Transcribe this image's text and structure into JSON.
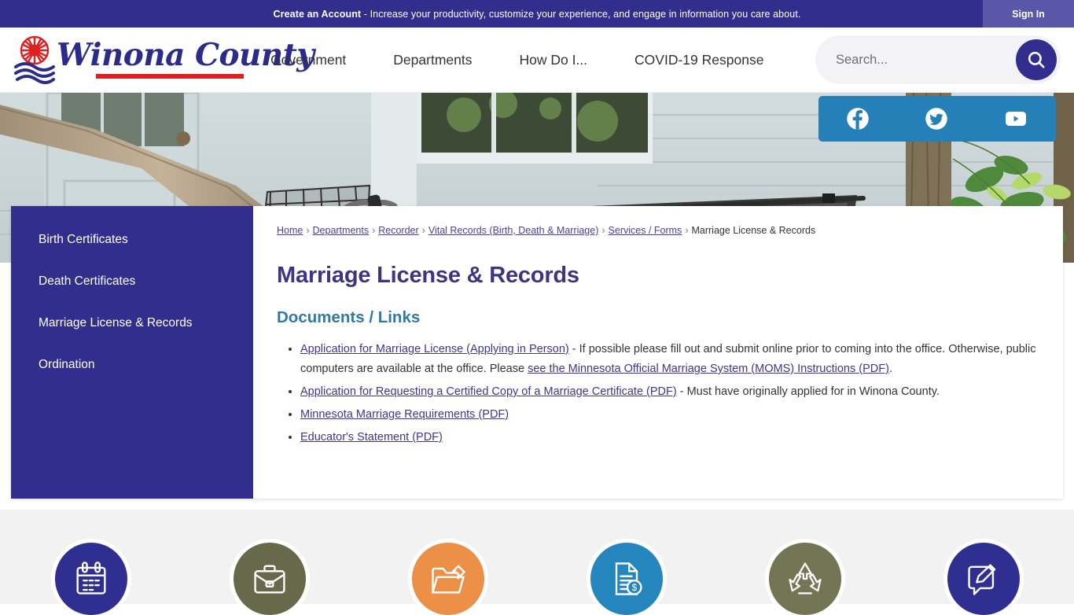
{
  "topbar": {
    "message_bold": "Create an Account",
    "message_rest": " - Increase your productivity, customize your experience, and engage in information you care about.",
    "signin_label": "Sign In"
  },
  "header": {
    "logo_text": "Winona County",
    "nav": [
      {
        "label": "Government"
      },
      {
        "label": "Departments"
      },
      {
        "label": "How Do I..."
      },
      {
        "label": "COVID-19 Response"
      }
    ],
    "search": {
      "placeholder": "Search...",
      "value": "",
      "button_icon": "search-icon"
    }
  },
  "social": [
    {
      "name": "facebook-icon",
      "label": "Facebook"
    },
    {
      "name": "twitter-icon",
      "label": "Twitter"
    },
    {
      "name": "youtube-icon",
      "label": "YouTube"
    }
  ],
  "sidebar": {
    "items": [
      {
        "label": "Birth Certificates",
        "active": false
      },
      {
        "label": "Death Certificates",
        "active": false
      },
      {
        "label": "Marriage License & Records",
        "active": true
      },
      {
        "label": "Ordination",
        "active": false
      }
    ]
  },
  "breadcrumb": [
    {
      "label": "Home",
      "link": true
    },
    {
      "label": "Departments",
      "link": true
    },
    {
      "label": "Recorder",
      "link": true
    },
    {
      "label": "Vital Records (Birth, Death & Marriage)",
      "link": true
    },
    {
      "label": "Services / Forms",
      "link": true
    },
    {
      "label": "Marriage License & Records",
      "link": false
    }
  ],
  "main": {
    "page_title": "Marriage License & Records",
    "section_title": "Documents / Links",
    "documents": [
      {
        "link": "Application for Marriage License (Applying in Person)",
        "text_after": " - If possible please fill out and submit online prior to coming into the office. Otherwise, public computers are available at the office. Please ",
        "link2": "see the Minnesota Official Marriage System (MOMS) Instructions (PDF)",
        "text_end": "."
      },
      {
        "link": "Application for Requesting a Certified Copy of a Marriage Certificate (PDF)",
        "text_after": " - Must have originally applied for in Winona County.",
        "link2": "",
        "text_end": ""
      },
      {
        "link": "Minnesota Marriage Requirements (PDF)",
        "text_after": "",
        "link2": "",
        "text_end": ""
      },
      {
        "link": "Educator's Statement (PDF)",
        "text_after": "",
        "link2": "",
        "text_end": ""
      }
    ]
  },
  "quicklinks": [
    {
      "icon": "calendar-icon",
      "color": "#2f2f91"
    },
    {
      "icon": "briefcase-icon",
      "color": "#666a4a"
    },
    {
      "icon": "folder-icon",
      "color": "#ec8f47"
    },
    {
      "icon": "pay-bill-icon",
      "color": "#2585bd"
    },
    {
      "icon": "recycle-icon",
      "color": "#737555"
    },
    {
      "icon": "report-concern-icon",
      "color": "#2f2f91"
    }
  ],
  "colors": {
    "brand_purple": "#322e8e",
    "social_blue": "#2580b7",
    "heading_purple": "#3b3582",
    "subheading_blue": "#2f79a8",
    "link": "#3c3694"
  }
}
